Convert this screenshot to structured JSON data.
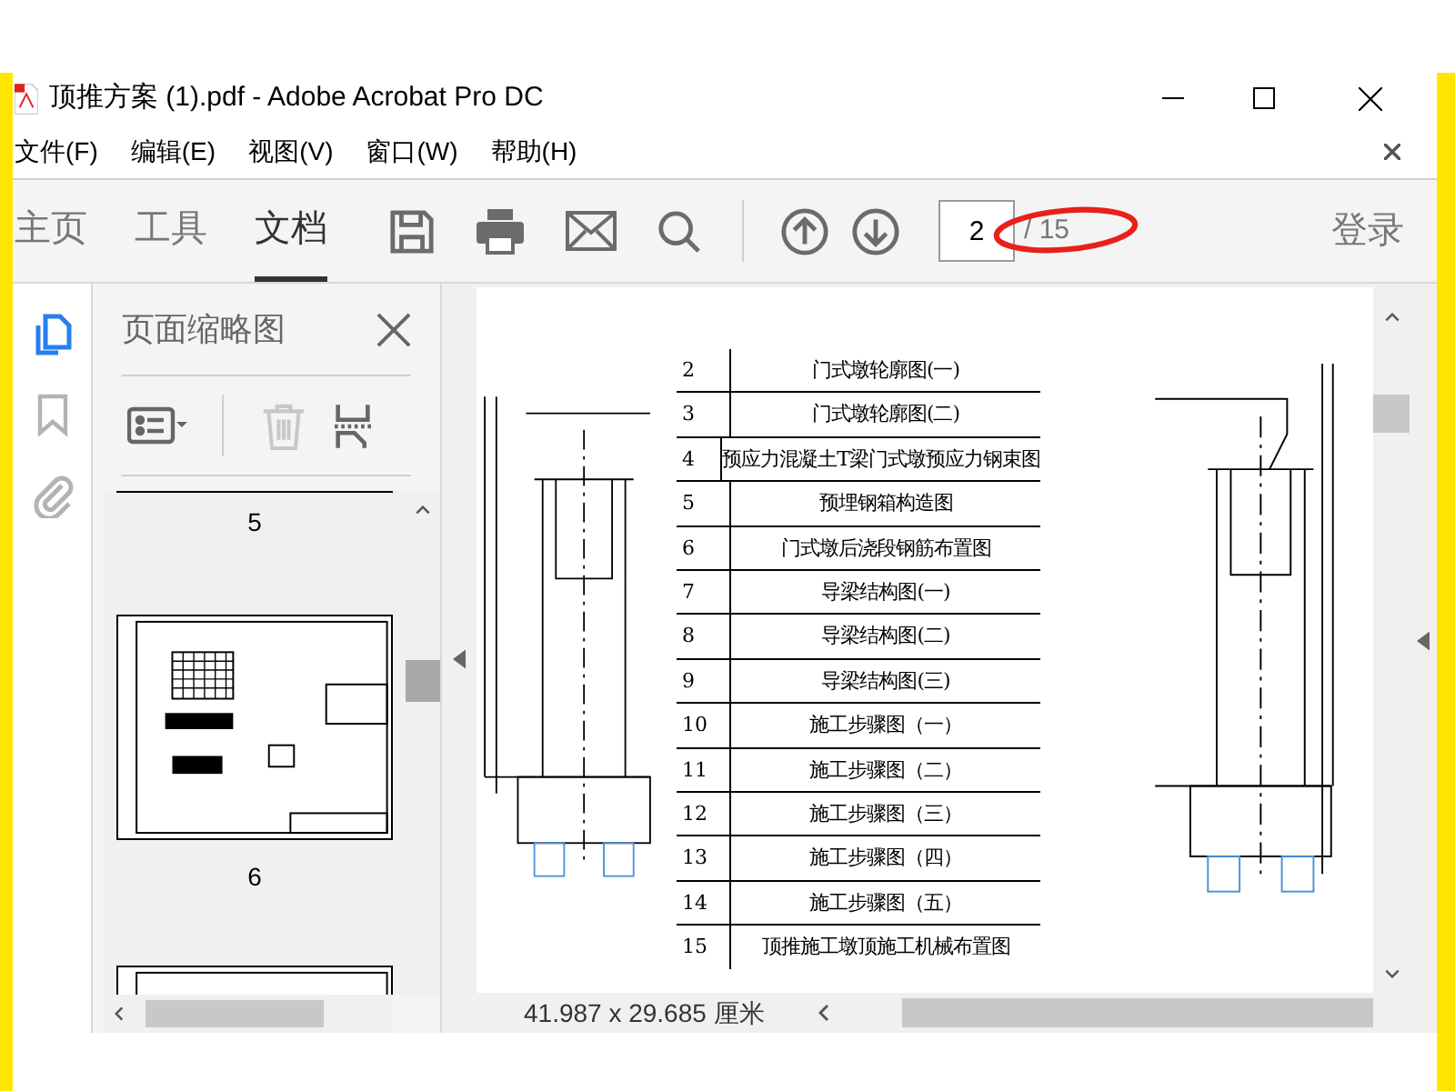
{
  "window": {
    "title": "顶推方案 (1).pdf - Adobe Acrobat Pro DC"
  },
  "menu": [
    "文件(F)",
    "编辑(E)",
    "视图(V)",
    "窗口(W)",
    "帮助(H)"
  ],
  "tabs": [
    {
      "label": "主页",
      "selected": false
    },
    {
      "label": "工具",
      "selected": false
    },
    {
      "label": "文档",
      "selected": true
    }
  ],
  "page_nav": {
    "value": "2",
    "total": "/ 15"
  },
  "sign_in": "登录",
  "rail": [
    {
      "kind": "pages",
      "selected": true
    },
    {
      "kind": "bookmarks",
      "selected": false
    },
    {
      "kind": "attachments",
      "selected": false
    }
  ],
  "side_panel": {
    "title": "页面缩略图",
    "thumbnails": [
      {
        "label": "5"
      },
      {
        "label": "6"
      }
    ]
  },
  "sheet_list": [
    {
      "no": "2",
      "title": "门式墩轮廓图(一)"
    },
    {
      "no": "3",
      "title": "门式墩轮廓图(二)"
    },
    {
      "no": "4",
      "title": "预应力混凝土T梁门式墩预应力钢束图"
    },
    {
      "no": "5",
      "title": "预埋钢箱构造图"
    },
    {
      "no": "6",
      "title": "门式墩后浇段钢筋布置图"
    },
    {
      "no": "7",
      "title": "导梁结构图(一)"
    },
    {
      "no": "8",
      "title": "导梁结构图(二)"
    },
    {
      "no": "9",
      "title": "导梁结构图(三)"
    },
    {
      "no": "10",
      "title": "施工步骤图（一）"
    },
    {
      "no": "11",
      "title": "施工步骤图（二）"
    },
    {
      "no": "12",
      "title": "施工步骤图（三）"
    },
    {
      "no": "13",
      "title": "施工步骤图（四）"
    },
    {
      "no": "14",
      "title": "施工步骤图（五）"
    },
    {
      "no": "15",
      "title": "顶推施工墩顶施工机械布置图"
    }
  ],
  "status_bar": "41.987 x 29.685 厘米"
}
